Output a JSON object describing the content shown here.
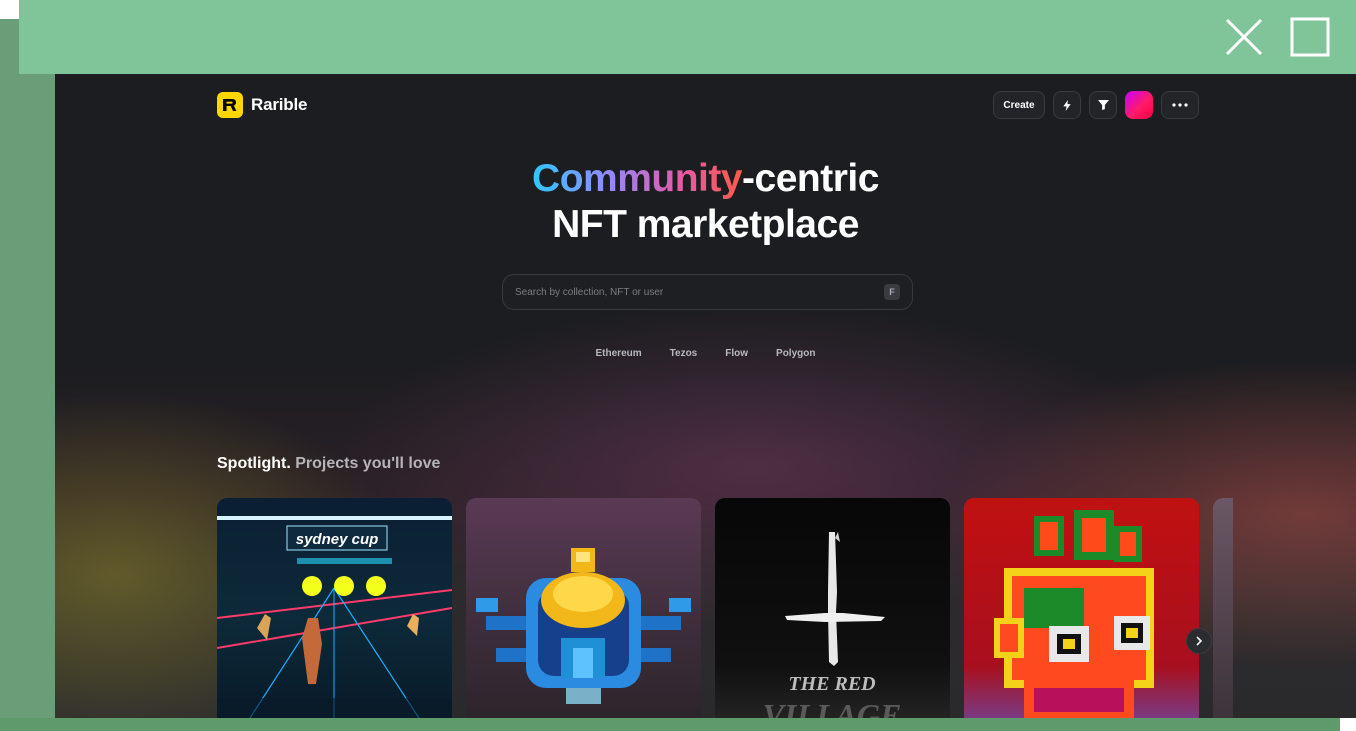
{
  "window": {
    "close_icon": "close-icon",
    "maximize_icon": "maximize-icon"
  },
  "header": {
    "logo_text": "Rarible",
    "create_label": "Create",
    "icons": [
      "lightning-icon",
      "filter-icon",
      "avatar",
      "more-icon"
    ]
  },
  "hero": {
    "gradient_word": "Community",
    "line1_rest": "-centric",
    "line2": "NFT marketplace"
  },
  "search": {
    "placeholder": "Search by collection, NFT or user",
    "shortcut": "F"
  },
  "chains": [
    "Ethereum",
    "Tezos",
    "Flow",
    "Polygon"
  ],
  "spotlight": {
    "title_strong": "Spotlight.",
    "title_rest": "Projects you'll love",
    "cards": [
      {
        "name": "sydney-cup",
        "art_text": "sydney cup"
      },
      {
        "name": "pixel-beetle"
      },
      {
        "name": "the-red-village",
        "art_text": "THE RED",
        "art_text2": "VILLAGE"
      },
      {
        "name": "pixel-creature"
      }
    ]
  },
  "colors": {
    "brand_yellow": "#ffd700",
    "topbar_green": "#80c49a",
    "app_bg": "#1c1d20"
  }
}
